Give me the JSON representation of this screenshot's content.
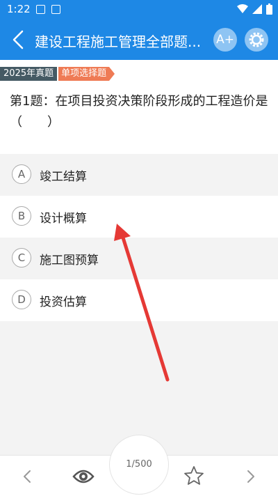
{
  "status_bar": {
    "time": "1:22"
  },
  "header": {
    "title": "建设工程施工管理全部题...",
    "font_button": "A+"
  },
  "tags": {
    "year": "2025年真题",
    "type": "单项选择题"
  },
  "question": {
    "text": "第1题：在项目投资决策阶段形成的工程造价是（　　）"
  },
  "options": [
    {
      "letter": "A",
      "text": "竣工结算"
    },
    {
      "letter": "B",
      "text": "设计概算"
    },
    {
      "letter": "C",
      "text": "施工图预算"
    },
    {
      "letter": "D",
      "text": "投资估算"
    }
  ],
  "counter": "1/500",
  "colors": {
    "primary": "#1e88e5",
    "tag_year": "#455a64",
    "tag_type": "#ef7b55",
    "annotation_arrow": "#e53935"
  },
  "icons": [
    "image-icon",
    "a-icon",
    "wifi-icon",
    "signal-icon",
    "battery-icon",
    "back-icon",
    "font-size-icon",
    "gear-icon",
    "prev-icon",
    "eye-icon",
    "star-icon",
    "next-icon"
  ]
}
